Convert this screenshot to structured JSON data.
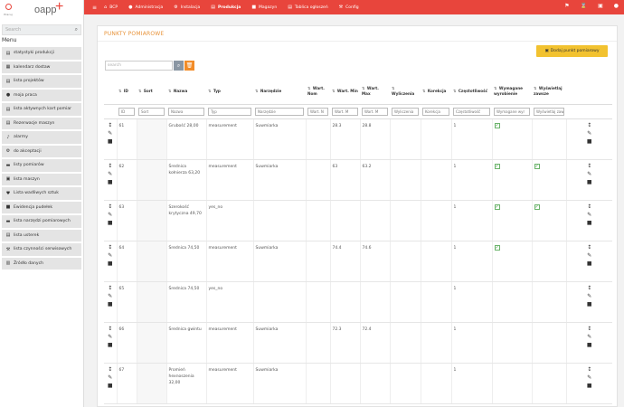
{
  "logo": {
    "mark_label": "Pracuj",
    "brand": "oapp"
  },
  "sidebar": {
    "search_placeholder": "Search",
    "menu_title": "Menu",
    "items": [
      {
        "label": "statystyki produkcji",
        "icon": "chart-icon"
      },
      {
        "label": "kalendarz dostaw",
        "icon": "calendar-icon"
      },
      {
        "label": "lista projektów",
        "icon": "list-icon"
      },
      {
        "label": "moja praca",
        "icon": "user-icon"
      },
      {
        "label": "lista aktywnych kart pomiar",
        "icon": "list-icon"
      },
      {
        "label": "Rezerwacje maszyn",
        "icon": "keyboard-icon"
      },
      {
        "label": "alarmy",
        "icon": "bell-icon"
      },
      {
        "label": "do akceptacji",
        "icon": "gear-icon"
      },
      {
        "label": "listy pomiarów",
        "icon": "ruler-icon"
      },
      {
        "label": "lista maszyn",
        "icon": "machine-icon"
      },
      {
        "label": "Lista wadliwych sztuk",
        "icon": "heart-icon"
      },
      {
        "label": "Ewidencja pudełek",
        "icon": "box-icon"
      },
      {
        "label": "lista narzędzi pomiarowych",
        "icon": "ruler-icon"
      },
      {
        "label": "lista usterek",
        "icon": "list-icon"
      },
      {
        "label": "lista czynności serwisowych",
        "icon": "wrench-icon"
      },
      {
        "label": "Źródło danych",
        "icon": "database-icon"
      }
    ]
  },
  "topnav": {
    "items": [
      {
        "label": "BCP",
        "icon": "home-icon",
        "active": false
      },
      {
        "label": "Administracja",
        "icon": "user-icon",
        "active": false
      },
      {
        "label": "Instalacja",
        "icon": "gear-icon",
        "active": false
      },
      {
        "label": "Produkcja",
        "icon": "factory-icon",
        "active": true
      },
      {
        "label": "Magazyn",
        "icon": "truck-icon",
        "active": false
      },
      {
        "label": "Tablica ogłoszeń",
        "icon": "board-icon",
        "active": false
      },
      {
        "label": "Config",
        "icon": "wrench-icon",
        "active": false
      }
    ]
  },
  "page": {
    "title": "PUNKTY POMIAROWE",
    "add_button": "Dodaj punkt pomiarowy",
    "search_placeholder": "search"
  },
  "table": {
    "columns": [
      "",
      "ID",
      "Sort",
      "Nazwa",
      "Typ",
      "Narzędzie",
      "Wart. Nom",
      "Wart. Min",
      "Wart. Max",
      "Wyliczenia",
      "Korekcja",
      "Częstotliwość",
      "Wymagane wyrobienie",
      "Wyświetlaj zawsze",
      ""
    ],
    "filters": [
      "",
      "ID",
      "Sort",
      "Nazwa",
      "Typ",
      "Narzędzie",
      "Wart. N",
      "Wart. M",
      "Wart. M",
      "Wyliczenia",
      "Korekcja",
      "Częstotliwość",
      "Wymagane wyr",
      "Wyświetlaj zaw",
      ""
    ],
    "rows": [
      {
        "id": "61",
        "sort": "",
        "name": "Grubość 28,00",
        "type": "measurement",
        "tool": "Suwmiarka",
        "nom": "",
        "min": "28.3",
        "max": "28.8",
        "calc": "",
        "corr": "",
        "freq": "1",
        "req": true,
        "always": false
      },
      {
        "id": "62",
        "sort": "",
        "name": "Średnica kołnierza 63,20",
        "type": "measurement",
        "tool": "Suwmiarka",
        "nom": "",
        "min": "63",
        "max": "63.2",
        "calc": "",
        "corr": "",
        "freq": "1",
        "req": true,
        "always": true
      },
      {
        "id": "63",
        "sort": "",
        "name": "Szerokość krytyczna 49,70",
        "type": "yes_no",
        "tool": "",
        "nom": "",
        "min": "",
        "max": "",
        "calc": "",
        "corr": "",
        "freq": "1",
        "req": true,
        "always": true
      },
      {
        "id": "64",
        "sort": "",
        "name": "Średnica 74,50",
        "type": "measurement",
        "tool": "Suwmiarka",
        "nom": "",
        "min": "74.4",
        "max": "74.6",
        "calc": "",
        "corr": "",
        "freq": "1",
        "req": true,
        "always": false
      },
      {
        "id": "65",
        "sort": "",
        "name": "Średnica 74,50",
        "type": "yes_no",
        "tool": "",
        "nom": "",
        "min": "",
        "max": "",
        "calc": "",
        "corr": "",
        "freq": "1",
        "req": false,
        "always": false
      },
      {
        "id": "66",
        "sort": "",
        "name": "Średnica gwintu",
        "type": "measurement",
        "tool": "Suwmiarka",
        "nom": "",
        "min": "72.3",
        "max": "72.4",
        "calc": "",
        "corr": "",
        "freq": "1",
        "req": false,
        "always": false
      },
      {
        "id": "67",
        "sort": "",
        "name": "Promień hexnoszenia 32,00",
        "type": "measurement",
        "tool": "Suwmiarka",
        "nom": "",
        "min": "",
        "max": "",
        "calc": "",
        "corr": "",
        "freq": "1",
        "req": false,
        "always": false
      }
    ]
  },
  "colors": {
    "accent": "#e8453c",
    "title": "#e8943c",
    "add_button": "#f2c230",
    "check": "#3a9a3a"
  }
}
